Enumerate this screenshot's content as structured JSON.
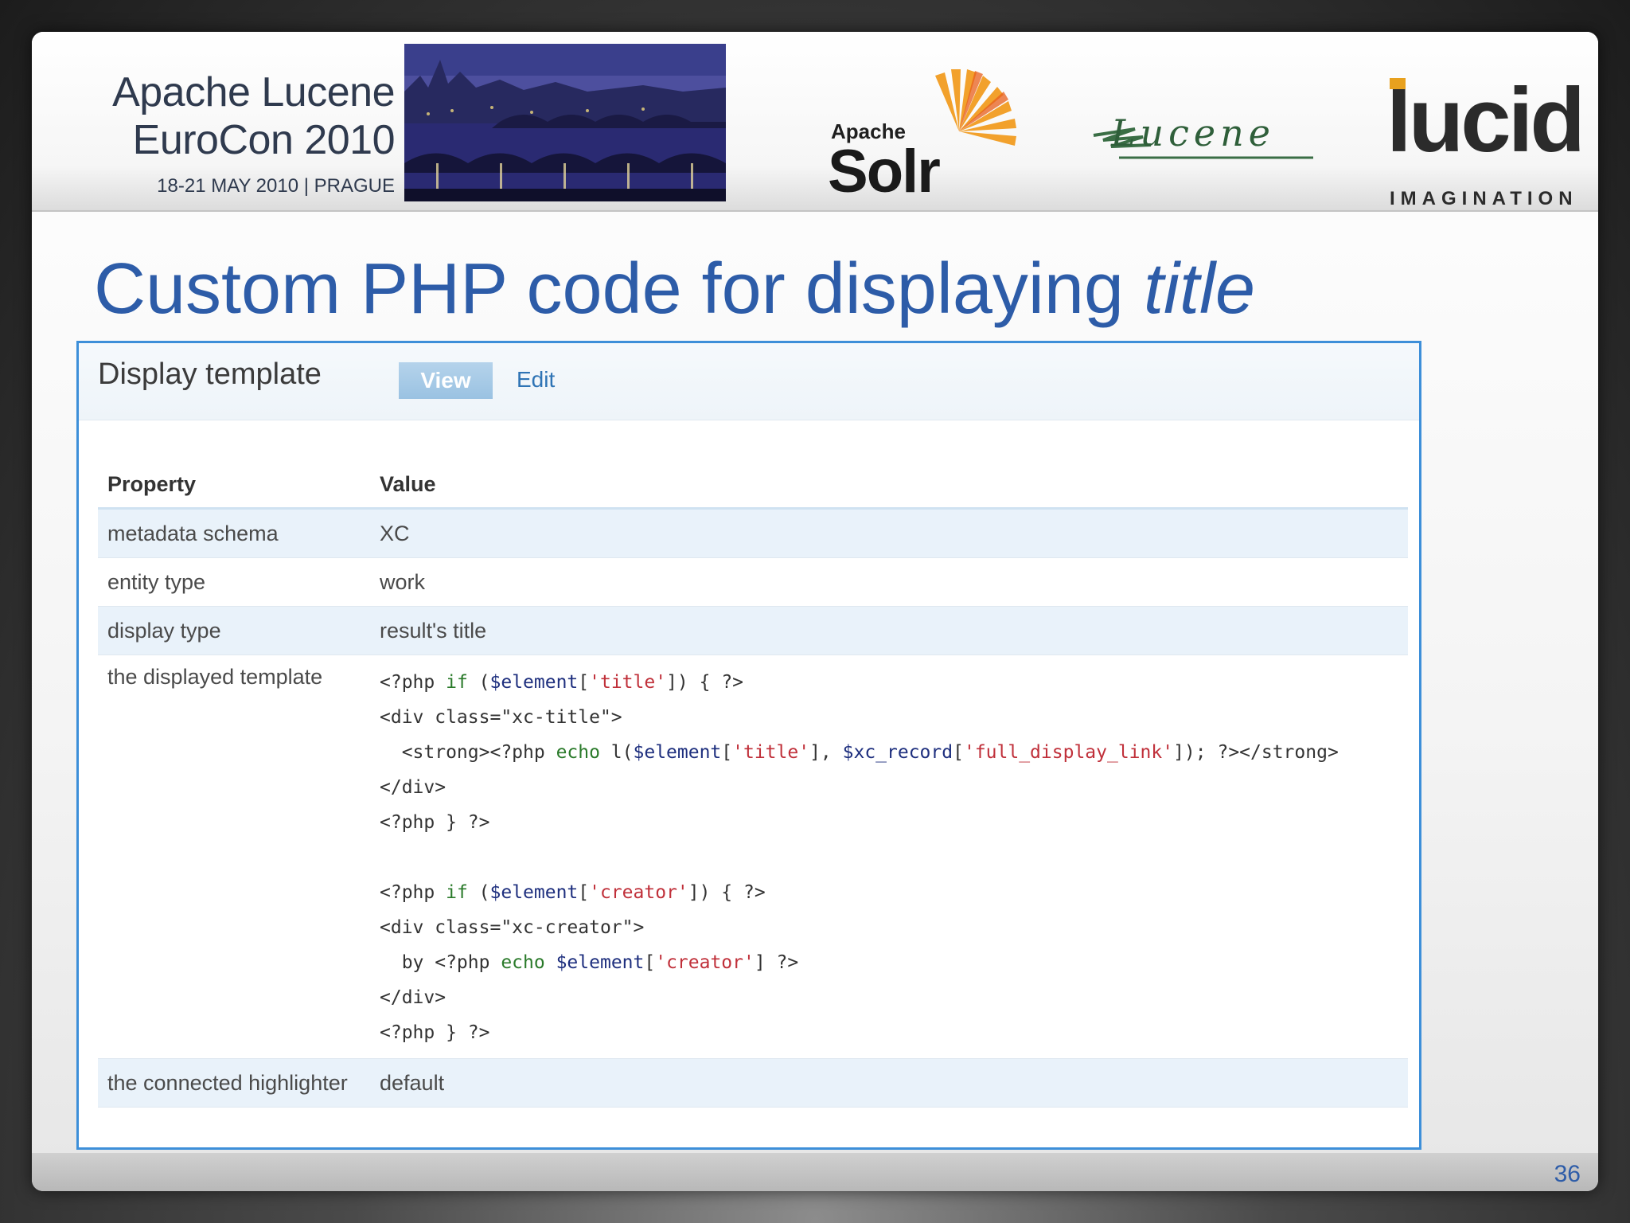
{
  "header": {
    "conference_line1": "Apache Lucene",
    "conference_line2": "EuroCon 2010",
    "conference_date": "18-21 MAY 2010  |  PRAGUE",
    "solr_apache": "Apache",
    "solr_word": "Solr",
    "lucene_word": "Lucene",
    "lucid_word": "lucid",
    "lucid_sub": "IMAGINATION"
  },
  "slide": {
    "title_prefix": "Custom PHP code for displaying ",
    "title_emphasis": "title",
    "page_number": "36"
  },
  "panel": {
    "title": "Display template",
    "tabs": [
      "View",
      "Edit"
    ],
    "active_tab": "View",
    "columns": [
      "Property",
      "Value"
    ],
    "rows": [
      {
        "property": "metadata schema",
        "value": "XC"
      },
      {
        "property": "entity type",
        "value": "work"
      },
      {
        "property": "display type",
        "value": "result's title"
      }
    ],
    "template_label": "the displayed template",
    "template_code": [
      "<?php if ($element['title']) { ?>",
      "<div class=\"xc-title\">",
      "  <strong><?php echo l($element['title'], $xc_record['full_display_link']); ?></strong>",
      "</div>",
      "<?php } ?>",
      "",
      "<?php if ($element['creator']) { ?>",
      "<div class=\"xc-creator\">",
      "  by <?php echo $element['creator'] ?>",
      "</div>",
      "<?php } ?>"
    ],
    "highlighter_label": "the connected highlighter",
    "highlighter_value": "default"
  },
  "colors": {
    "title_blue": "#2d5ca8",
    "panel_border": "#3d8fd9",
    "row_alt": "#e9f2fa",
    "code_keyword": "#2a7a2a",
    "code_string": "#c0303a",
    "code_variable": "#1e2f7e"
  }
}
